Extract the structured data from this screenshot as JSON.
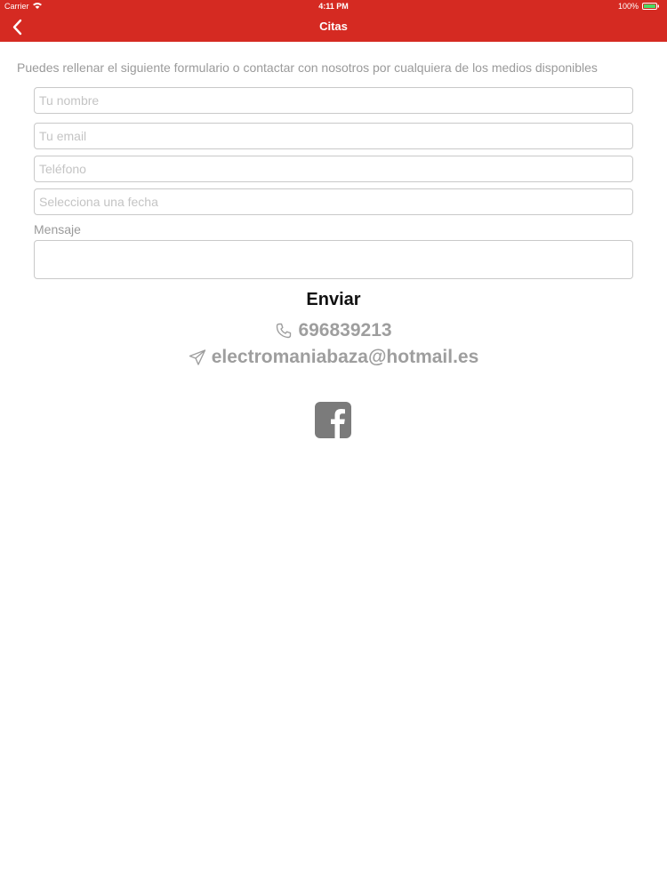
{
  "status_bar": {
    "carrier": "Carrier",
    "time": "4:11 PM",
    "battery": "100%"
  },
  "nav": {
    "title": "Citas",
    "back_icon": "chevron-left-icon"
  },
  "form": {
    "intro": "Puedes rellenar el siguiente formulario o contactar con nosotros por cualquiera de los medios disponibles",
    "name_placeholder": "Tu nombre",
    "email_placeholder": "Tu email",
    "phone_placeholder": "Teléfono",
    "date_placeholder": "Selecciona una fecha",
    "message_label": "Mensaje",
    "send_label": "Enviar"
  },
  "contact": {
    "phone": "696839213",
    "phone_icon": "phone-icon",
    "email": "electromaniabaza@hotmail.es",
    "email_icon": "send-icon",
    "social_icon": "facebook-icon"
  },
  "colors": {
    "brand": "#d52a22",
    "muted_text": "#9e9e9e",
    "facebook_bg": "#7b7b7b"
  }
}
